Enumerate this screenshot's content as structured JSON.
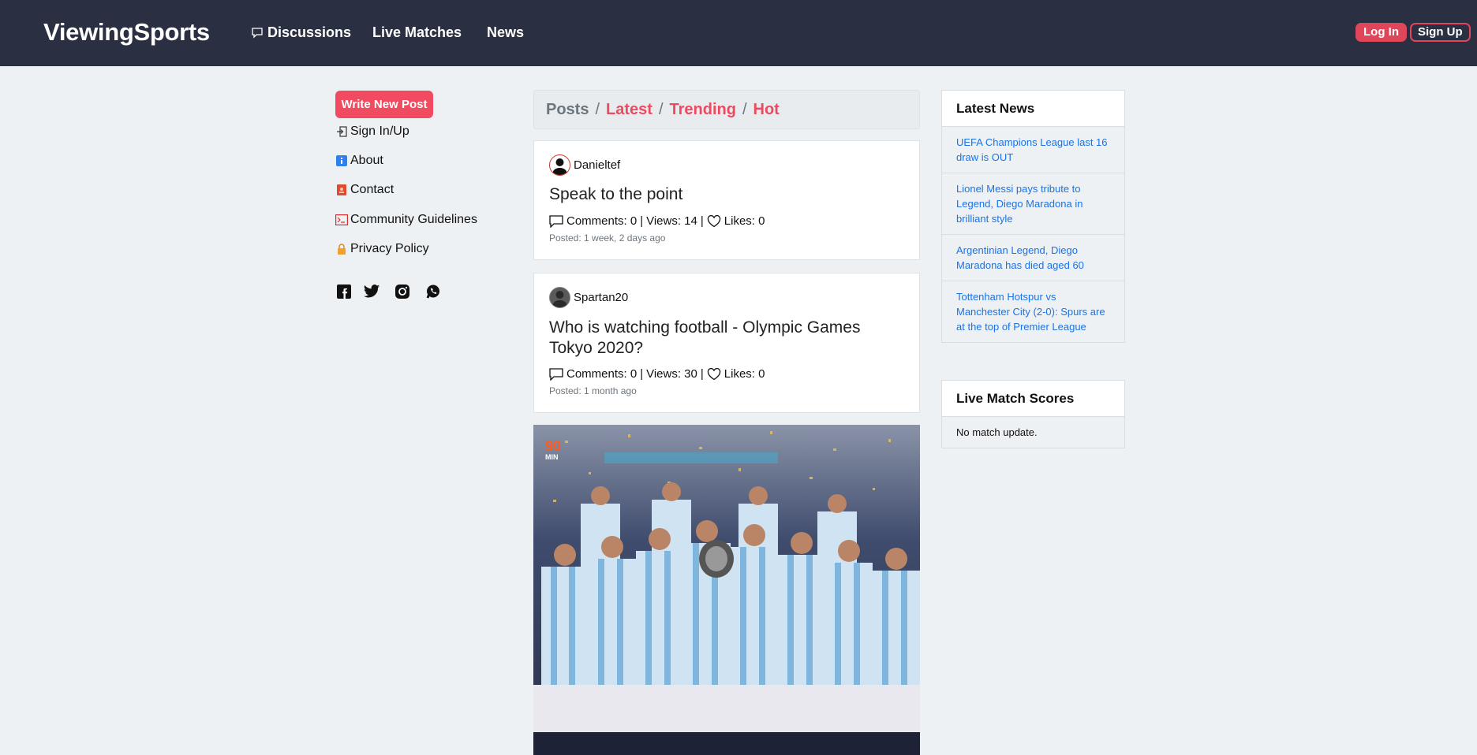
{
  "navbar": {
    "brand": "ViewingSports",
    "links": [
      "Discussions",
      "Live Matches",
      "News"
    ],
    "login": "Log In",
    "signup": "Sign Up"
  },
  "sidebar": {
    "write_button": "Write New Post",
    "items": [
      {
        "label": "Sign In/Up",
        "icon": "sign-in-icon"
      },
      {
        "label": "About",
        "icon": "info-icon"
      },
      {
        "label": "Contact",
        "icon": "contact-book-icon"
      },
      {
        "label": "Community Guidelines",
        "icon": "terminal-icon"
      },
      {
        "label": "Privacy Policy",
        "icon": "lock-icon"
      }
    ],
    "social": [
      "facebook-icon",
      "twitter-icon",
      "instagram-icon",
      "whatsapp-icon"
    ]
  },
  "breadcrumb": {
    "posts": "Posts",
    "latest": "Latest",
    "trending": "Trending",
    "hot": "Hot",
    "sep": "/"
  },
  "posts": [
    {
      "author": "Danieltef",
      "title": "Speak to the point",
      "comments": "Comments: 0",
      "views": "Views: 14",
      "likes": "Likes: 0",
      "posted": "Posted: 1 week, 2 days ago"
    },
    {
      "author": "Spartan20",
      "title": "Who is watching football - Olympic Games Tokyo 2020?",
      "comments": "Comments: 0",
      "views": "Views: 30",
      "likes": "Likes: 0",
      "posted": "Posted: 1 month ago"
    }
  ],
  "photo_badge": {
    "top": "90",
    "bottom": "MIN"
  },
  "latest_news": {
    "title": "Latest News",
    "items": [
      "UEFA Champions League last 16 draw is OUT",
      "Lionel Messi pays tribute to Legend, Diego Maradona in brilliant style",
      "Argentinian Legend, Diego Maradona has died aged 60",
      "Tottenham Hotspur vs Manchester City (2-0): Spurs are at the top of Premier League"
    ]
  },
  "live_scores": {
    "title": "Live Match Scores",
    "empty": "No match update."
  },
  "colors": {
    "navbar": "#2b2f42",
    "accent": "#f04b61",
    "link": "#1a73e8",
    "background": "#edf1f4"
  }
}
